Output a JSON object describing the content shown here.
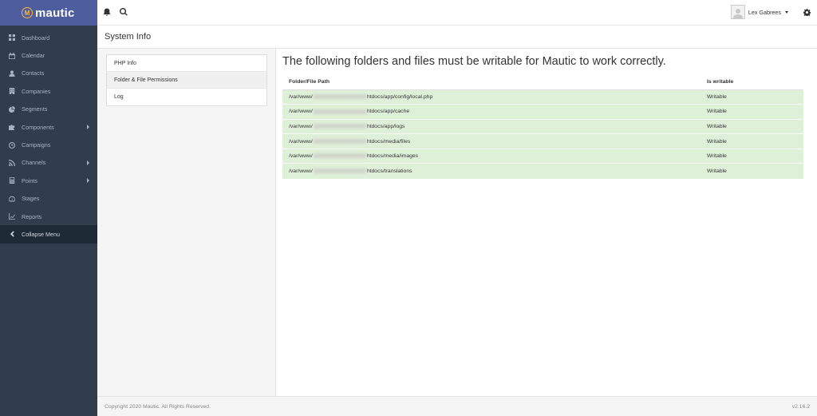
{
  "brand": {
    "name": "mautic",
    "logo_letter": "M",
    "accent": "#4e5d9d",
    "logo_color": "#fdb933"
  },
  "sidebar": {
    "items": [
      {
        "label": "Dashboard",
        "icon": "dashboard-icon"
      },
      {
        "label": "Calendar",
        "icon": "calendar-icon"
      },
      {
        "label": "Contacts",
        "icon": "user-icon"
      },
      {
        "label": "Companies",
        "icon": "building-icon"
      },
      {
        "label": "Segments",
        "icon": "pie-icon"
      },
      {
        "label": "Components",
        "icon": "puzzle-icon",
        "has_submenu": true
      },
      {
        "label": "Campaigns",
        "icon": "clock-icon"
      },
      {
        "label": "Channels",
        "icon": "rss-icon",
        "has_submenu": true
      },
      {
        "label": "Points",
        "icon": "calculator-icon",
        "has_submenu": true
      },
      {
        "label": "Stages",
        "icon": "tachometer-icon"
      },
      {
        "label": "Reports",
        "icon": "line-chart-icon"
      }
    ],
    "collapse_label": "Collapse Menu"
  },
  "topbar": {
    "user_name": "Lex Gabrees"
  },
  "page": {
    "title": "System Info"
  },
  "settings_menu": {
    "items": [
      "PHP Info",
      "Folder & File Permissions",
      "Log"
    ],
    "active_index": 1
  },
  "permissions": {
    "heading": "The following folders and files must be writable for Mautic to work correctly.",
    "columns": [
      "Folder/File Path",
      "Is writable"
    ],
    "rows": [
      {
        "prefix": "/var/www/",
        "suffix": "htdocs/app/config/local.php",
        "status": "Writable"
      },
      {
        "prefix": "/var/www/",
        "suffix": "htdocs/app/cache",
        "status": "Writable"
      },
      {
        "prefix": "/var/www/",
        "suffix": "htdocs/app/logs",
        "status": "Writable"
      },
      {
        "prefix": "/var/www/",
        "suffix": "htdocs/media/files",
        "status": "Writable"
      },
      {
        "prefix": "/var/www/",
        "suffix": "htdocs/media/images",
        "status": "Writable"
      },
      {
        "prefix": "/var/www/",
        "suffix": "htdocs/translations",
        "status": "Writable"
      }
    ],
    "row_color": "#dff0d8"
  },
  "footer": {
    "copyright": "Copyright 2020 Mautic. All Rights Reserved.",
    "version": "v2.16.2"
  }
}
